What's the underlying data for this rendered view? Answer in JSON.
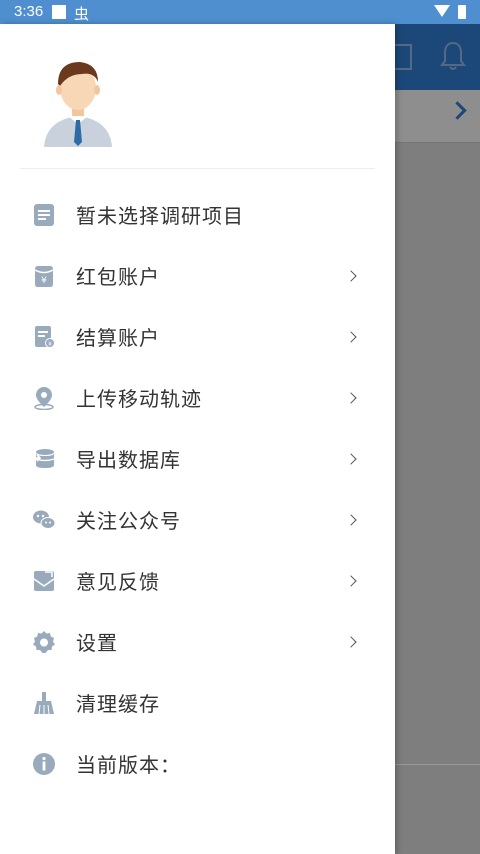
{
  "status_bar": {
    "time": "3:36",
    "app_glyph": "虫"
  },
  "menu": {
    "items": [
      {
        "label": "暂未选择调研项目",
        "icon": "document-list-icon",
        "has_arrow": false
      },
      {
        "label": "红包账户",
        "icon": "red-packet-icon",
        "has_arrow": true
      },
      {
        "label": "结算账户",
        "icon": "settlement-bill-icon",
        "has_arrow": true
      },
      {
        "label": "上传移动轨迹",
        "icon": "location-pin-icon",
        "has_arrow": true
      },
      {
        "label": "导出数据库",
        "icon": "database-export-icon",
        "has_arrow": true
      },
      {
        "label": "关注公众号",
        "icon": "wechat-icon",
        "has_arrow": true
      },
      {
        "label": "意见反馈",
        "icon": "feedback-mail-icon",
        "has_arrow": true
      },
      {
        "label": "设置",
        "icon": "gear-icon",
        "has_arrow": true
      },
      {
        "label": "清理缓存",
        "icon": "broom-icon",
        "has_arrow": false
      },
      {
        "label": "当前版本：",
        "icon": "info-icon",
        "has_arrow": false
      }
    ]
  },
  "colors": {
    "accent": "#2f7cd0",
    "icon": "#9aaabd",
    "status_bar": "#4f8fd0"
  }
}
